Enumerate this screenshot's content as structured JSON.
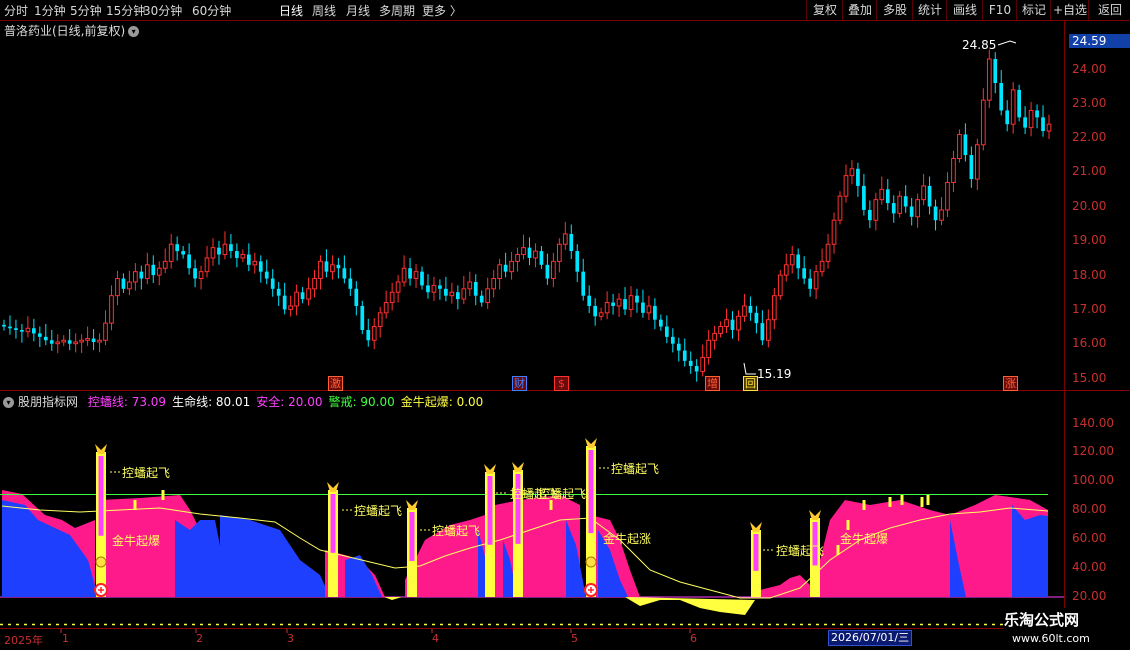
{
  "toolbar": {
    "timeframes": [
      "分时",
      "1分钟",
      "5分钟",
      "15分钟",
      "30分钟",
      "60分钟",
      "日线",
      "周线",
      "月线",
      "多周期",
      "更多"
    ],
    "active": "日线",
    "right_buttons": [
      "复权",
      "叠加",
      "多股",
      "统计",
      "画线",
      "F10",
      "标记",
      "+自选",
      "返回"
    ]
  },
  "stock": {
    "title": "普洛药业(日线,前复权)",
    "current_price_tag": "24.59"
  },
  "price_axis": [
    "24.00",
    "23.00",
    "22.00",
    "21.00",
    "20.00",
    "19.00",
    "18.00",
    "17.00",
    "16.00",
    "15.00"
  ],
  "indicator_axis": [
    "140.00",
    "120.00",
    "100.00",
    "80.00",
    "60.00",
    "40.00",
    "20.00"
  ],
  "price_annotations": {
    "high": "24.85",
    "low": "15.19"
  },
  "event_markers": [
    {
      "label": "激",
      "color": "#ff6030"
    },
    {
      "label": "财",
      "color": "#4080ff"
    },
    {
      "label": "$",
      "color": "#ff3030"
    },
    {
      "label": "增",
      "color": "#ff6030"
    },
    {
      "label": "回",
      "color": "#ffe040"
    },
    {
      "label": "涨",
      "color": "#ff6030"
    }
  ],
  "indicator": {
    "name": "股朋指标网",
    "values": [
      {
        "label": "控蟠线:",
        "value": "73.09",
        "color": "#ff40ff"
      },
      {
        "label": "生命线:",
        "value": "80.01",
        "color": "#ffffff"
      },
      {
        "label": "安全:",
        "value": "20.00",
        "color": "#ff40ff"
      },
      {
        "label": "警戒:",
        "value": "90.00",
        "color": "#40ff40"
      },
      {
        "label": "金牛起爆:",
        "value": "0.00",
        "color": "#ffff40"
      }
    ]
  },
  "signal_labels": [
    "控蟠起飞",
    "控蟠起飞",
    "控蟠起飞",
    "控蟠起飞",
    "控蟠起飞",
    "控蟠起飞",
    "控蟠起飞"
  ],
  "bull_labels": [
    "金牛起爆",
    "金牛起涨",
    "金牛起爆"
  ],
  "x_axis": [
    "2025年",
    "1",
    "2",
    "3",
    "4",
    "5",
    "6"
  ],
  "cursor_date": "2026/07/01/三",
  "watermark": {
    "brand": "乐淘公式网",
    "url": "www.60lt.com"
  },
  "colors": {
    "up": "#ff3030",
    "down": "#00e5ff",
    "ind_pink": "#ff1a8c",
    "ind_blue": "#1f3fff",
    "warn_line": "#40ff40",
    "ma_line": "#ffff60",
    "bg": "#000000"
  }
}
